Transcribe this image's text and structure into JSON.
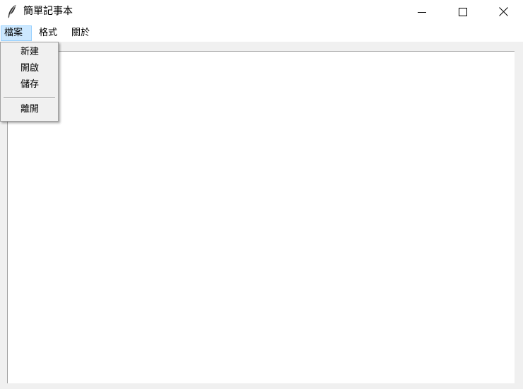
{
  "window": {
    "title": "簡單記事本",
    "icon": "feather-icon"
  },
  "menubar": {
    "items": [
      {
        "label": "檔案"
      },
      {
        "label": "格式"
      },
      {
        "label": "關於"
      }
    ]
  },
  "file_menu": {
    "items": [
      {
        "label": "新建"
      },
      {
        "label": "開啟"
      },
      {
        "label": "儲存"
      },
      {
        "label": "離開"
      }
    ]
  },
  "editor": {
    "content": ""
  },
  "colors": {
    "menu_highlight": "#cce8ff",
    "menu_highlight_border": "#99d1ff"
  }
}
